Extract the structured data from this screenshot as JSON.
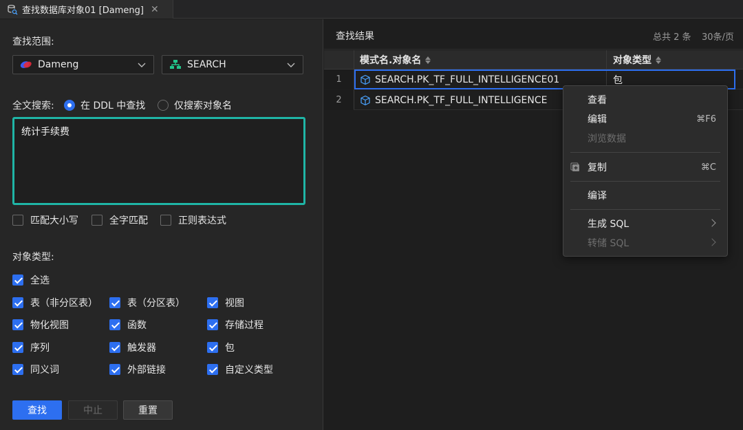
{
  "tab": {
    "title": "查找数据库对象01 [Dameng]",
    "icon": "db-search-icon"
  },
  "left": {
    "scope_label": "查找范围:",
    "datasource": {
      "value": "Dameng",
      "icon": "dameng-logo-icon"
    },
    "schema": {
      "value": "SEARCH",
      "icon": "schema-icon"
    },
    "fulltext_label": "全文搜索:",
    "radio_ddl": "在 DDL 中查找",
    "radio_name": "仅搜索对象名",
    "radio_selected": "ddl",
    "search_text": "统计手续费",
    "options": [
      {
        "label": "匹配大小写",
        "checked": false
      },
      {
        "label": "全字匹配",
        "checked": false
      },
      {
        "label": "正则表达式",
        "checked": false
      }
    ],
    "object_type_label": "对象类型:",
    "select_all": {
      "label": "全选",
      "checked": true
    },
    "object_types": [
      {
        "label": "表（非分区表）",
        "checked": true
      },
      {
        "label": "表（分区表）",
        "checked": true
      },
      {
        "label": "视图",
        "checked": true
      },
      {
        "label": "物化视图",
        "checked": true
      },
      {
        "label": "函数",
        "checked": true
      },
      {
        "label": "存储过程",
        "checked": true
      },
      {
        "label": "序列",
        "checked": true
      },
      {
        "label": "触发器",
        "checked": true
      },
      {
        "label": "包",
        "checked": true
      },
      {
        "label": "同义词",
        "checked": true
      },
      {
        "label": "外部链接",
        "checked": true
      },
      {
        "label": "自定义类型",
        "checked": true
      }
    ],
    "buttons": {
      "find": "查找",
      "stop": "中止",
      "reset": "重置"
    }
  },
  "right": {
    "title": "查找结果",
    "total": "总共 2 条",
    "pager": "30条/页",
    "columns": [
      "模式名.对象名",
      "对象类型"
    ],
    "rows": [
      {
        "num": "1",
        "name": "SEARCH.PK_TF_FULL_INTELLIGENCE01",
        "type": "包"
      },
      {
        "num": "2",
        "name": "SEARCH.PK_TF_FULL_INTELLIGENCE",
        "type": ""
      }
    ]
  },
  "context_menu": {
    "view": "查看",
    "edit": "编辑",
    "edit_shortcut": "⌘F6",
    "browse": "浏览数据",
    "copy": "复制",
    "copy_shortcut": "⌘C",
    "compile": "编译",
    "gen_sql": "生成 SQL",
    "dump_sql": "转储 SQL"
  },
  "colors": {
    "accent": "#2d6ff0",
    "textarea_border": "#1fb5a6",
    "schema_icon": "#22c58b",
    "dameng_logo": "#3a5cf0"
  }
}
